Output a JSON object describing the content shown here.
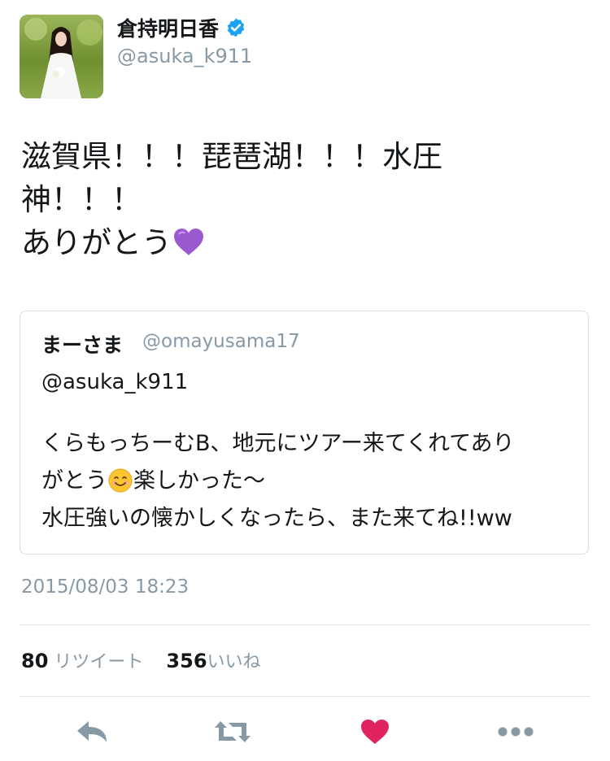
{
  "author": {
    "name": "倉持明日香",
    "handle": "@asuka_k911",
    "verified": true
  },
  "tweet": {
    "text": "滋賀県！！！琵琶湖！！！水圧\n神！！！\nありがとう",
    "trailing_emoji": "purple-heart"
  },
  "quoted_tweet": {
    "name": "まーさま",
    "handle": "@omayusama17",
    "reply_to": "@asuka_k911",
    "body_part1": "くらもっちーむB、地元にツアー来てくれてあり",
    "body_part2a": "がとう",
    "body_emoji": "smiling-face",
    "body_part2b": "楽しかった〜",
    "body_part3": "水圧強いの懐かしくなったら、また来てね!!ww"
  },
  "timestamp": "2015/08/03 18:23",
  "stats": {
    "retweets_count": "80",
    "retweets_label": "リツイート",
    "likes_count": "356",
    "likes_label": "いいね"
  },
  "actions": [
    "reply-icon",
    "retweet-icon",
    "like-icon",
    "more-icon"
  ],
  "colors": {
    "like": "#e0245e",
    "icon_gray": "#8899a6",
    "verified": "#1da1f2"
  }
}
